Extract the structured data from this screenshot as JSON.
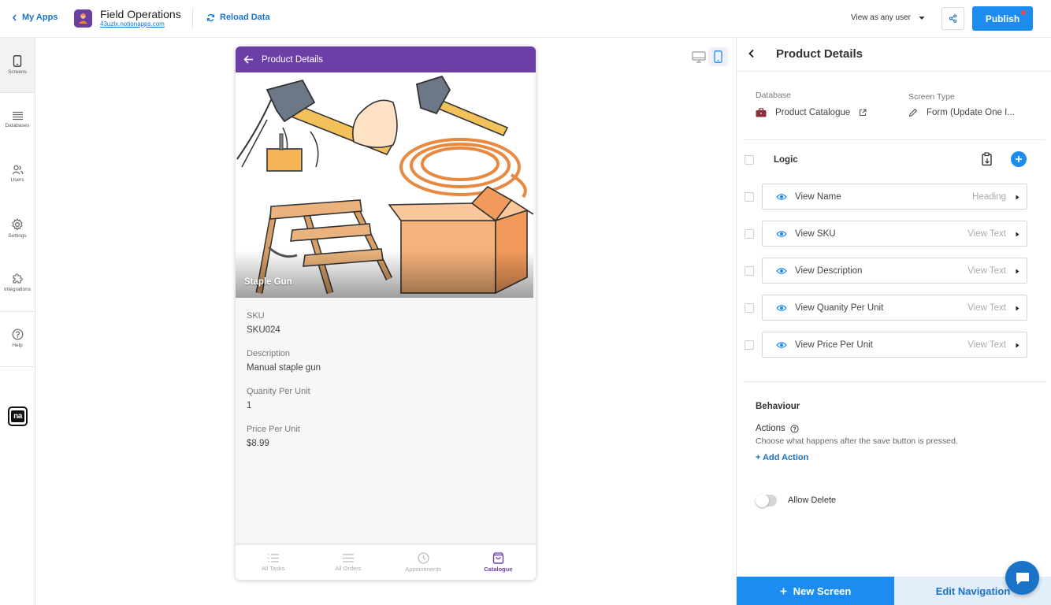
{
  "topbar": {
    "back_label": "My Apps",
    "app_title": "Field Operations",
    "app_url": "43uzlx.notionapps.com",
    "reload_label": "Reload Data",
    "view_as_label": "View as any user",
    "publish_label": "Publish"
  },
  "rail": {
    "items": [
      {
        "label": "Screens"
      },
      {
        "label": "Databases"
      },
      {
        "label": "Users"
      },
      {
        "label": "Settings"
      },
      {
        "label": "Integrations"
      },
      {
        "label": "Help"
      }
    ],
    "logo_text": "na"
  },
  "phone": {
    "header_title": "Product Details",
    "hero_title": "Staple Gun",
    "fields": [
      {
        "label": "SKU",
        "value": "SKU024"
      },
      {
        "label": "Description",
        "value": "Manual staple gun"
      },
      {
        "label": "Quanity Per Unit",
        "value": "1"
      },
      {
        "label": "Price Per Unit",
        "value": "$8.99"
      }
    ],
    "nav": [
      {
        "label": "All Tasks"
      },
      {
        "label": "All Orders"
      },
      {
        "label": "Appointments"
      },
      {
        "label": "Catalogue"
      }
    ]
  },
  "panel": {
    "title": "Product Details",
    "database_label": "Database",
    "database_value": "Product Catalogue",
    "screen_type_label": "Screen Type",
    "screen_type_value": "Form (Update One I...",
    "logic_label": "Logic",
    "views": [
      {
        "name": "View Name",
        "type": "Heading"
      },
      {
        "name": "View SKU",
        "type": "View Text"
      },
      {
        "name": "View Description",
        "type": "View Text"
      },
      {
        "name": "View Quanity Per Unit",
        "type": "View Text"
      },
      {
        "name": "View Price Per Unit",
        "type": "View Text"
      }
    ],
    "behaviour_title": "Behaviour",
    "actions_label": "Actions",
    "actions_desc": "Choose what happens after the save button is pressed.",
    "add_action_label": "+ Add Action",
    "allow_delete_label": "Allow Delete",
    "new_screen_label": "New Screen",
    "edit_nav_label": "Edit Navigation"
  },
  "colors": {
    "accent": "#1d8cf0",
    "link": "#1a73c7",
    "brand_purple": "#6c3fa6"
  }
}
